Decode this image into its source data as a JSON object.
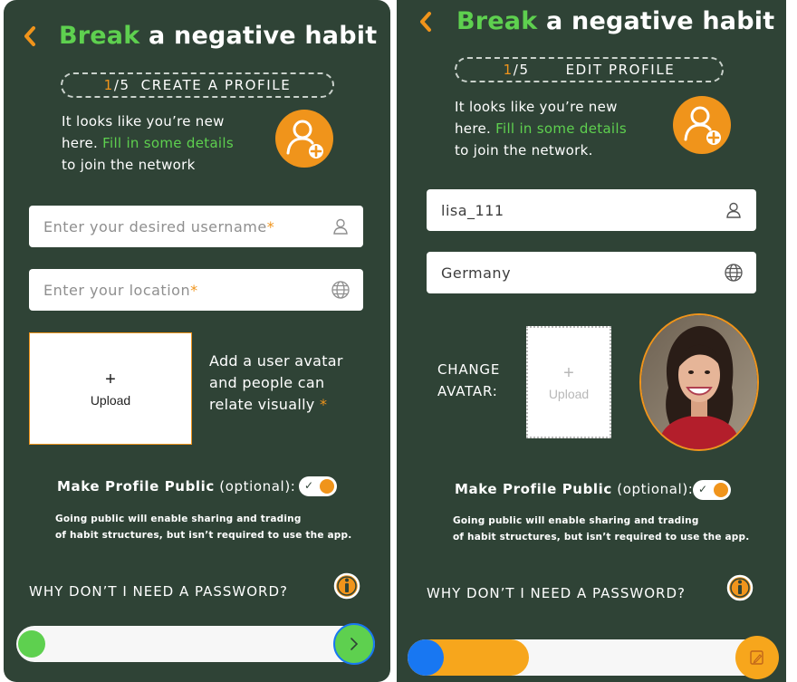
{
  "screens": [
    {
      "title_accent": "Break",
      "title_rest": "a negative habit",
      "step_current": "1",
      "step_total": "/5",
      "step_label": "CREATE A PROFILE",
      "intro_line1": "It looks like you’re new",
      "intro_line2a": "here.",
      "intro_line2b": "Fill in some details",
      "intro_line3": "to join the network",
      "username_placeholder": "Enter your desired username",
      "location_placeholder": "Enter your location",
      "required_mark": "*",
      "upload_plus": "+",
      "upload_label": "Upload",
      "avatar_hint_1": "Add a user avatar",
      "avatar_hint_2": "and people can",
      "avatar_hint_3": "relate visually",
      "public_label": "Make Profile Public",
      "public_optional": "(optional):",
      "toggle_check": "✓",
      "note_line1": "Going public will enable sharing and trading",
      "note_line2": "of habit structures, but isn’t required to use the app.",
      "password_question": "WHY DON’T I NEED A PASSWORD?",
      "progress": 0.0
    },
    {
      "title_accent": "Break",
      "title_rest": "a negative habit",
      "step_current": "1",
      "step_total": "/5",
      "step_label": "EDIT PROFILE",
      "intro_line1": "It looks like you’re new",
      "intro_line2a": "here.",
      "intro_line2b": "Fill in some details",
      "intro_line3": "to join the network.",
      "username_value": "lisa_111",
      "location_value": "Germany",
      "change_avatar_1": "CHANGE",
      "change_avatar_2": "AVATAR:",
      "upload_plus": "+",
      "upload_label": "Upload",
      "public_label": "Make Profile Public",
      "public_optional": "(optional):",
      "toggle_check": "✓",
      "note_line1": "Going public will enable sharing and trading",
      "note_line2": "of habit structures, but isn’t required to use the app.",
      "password_question": "WHY DON’T I NEED A PASSWORD?",
      "progress": 0.26
    }
  ],
  "colors": {
    "background": "#2f4336",
    "accent_green": "#5ed04f",
    "accent_orange": "#f0941b",
    "progress_blue": "#1877f2"
  },
  "icons": [
    "back-chevron-icon",
    "add-user-icon",
    "user-icon",
    "globe-icon",
    "info-icon",
    "arrow-right-icon",
    "edit-icon"
  ]
}
